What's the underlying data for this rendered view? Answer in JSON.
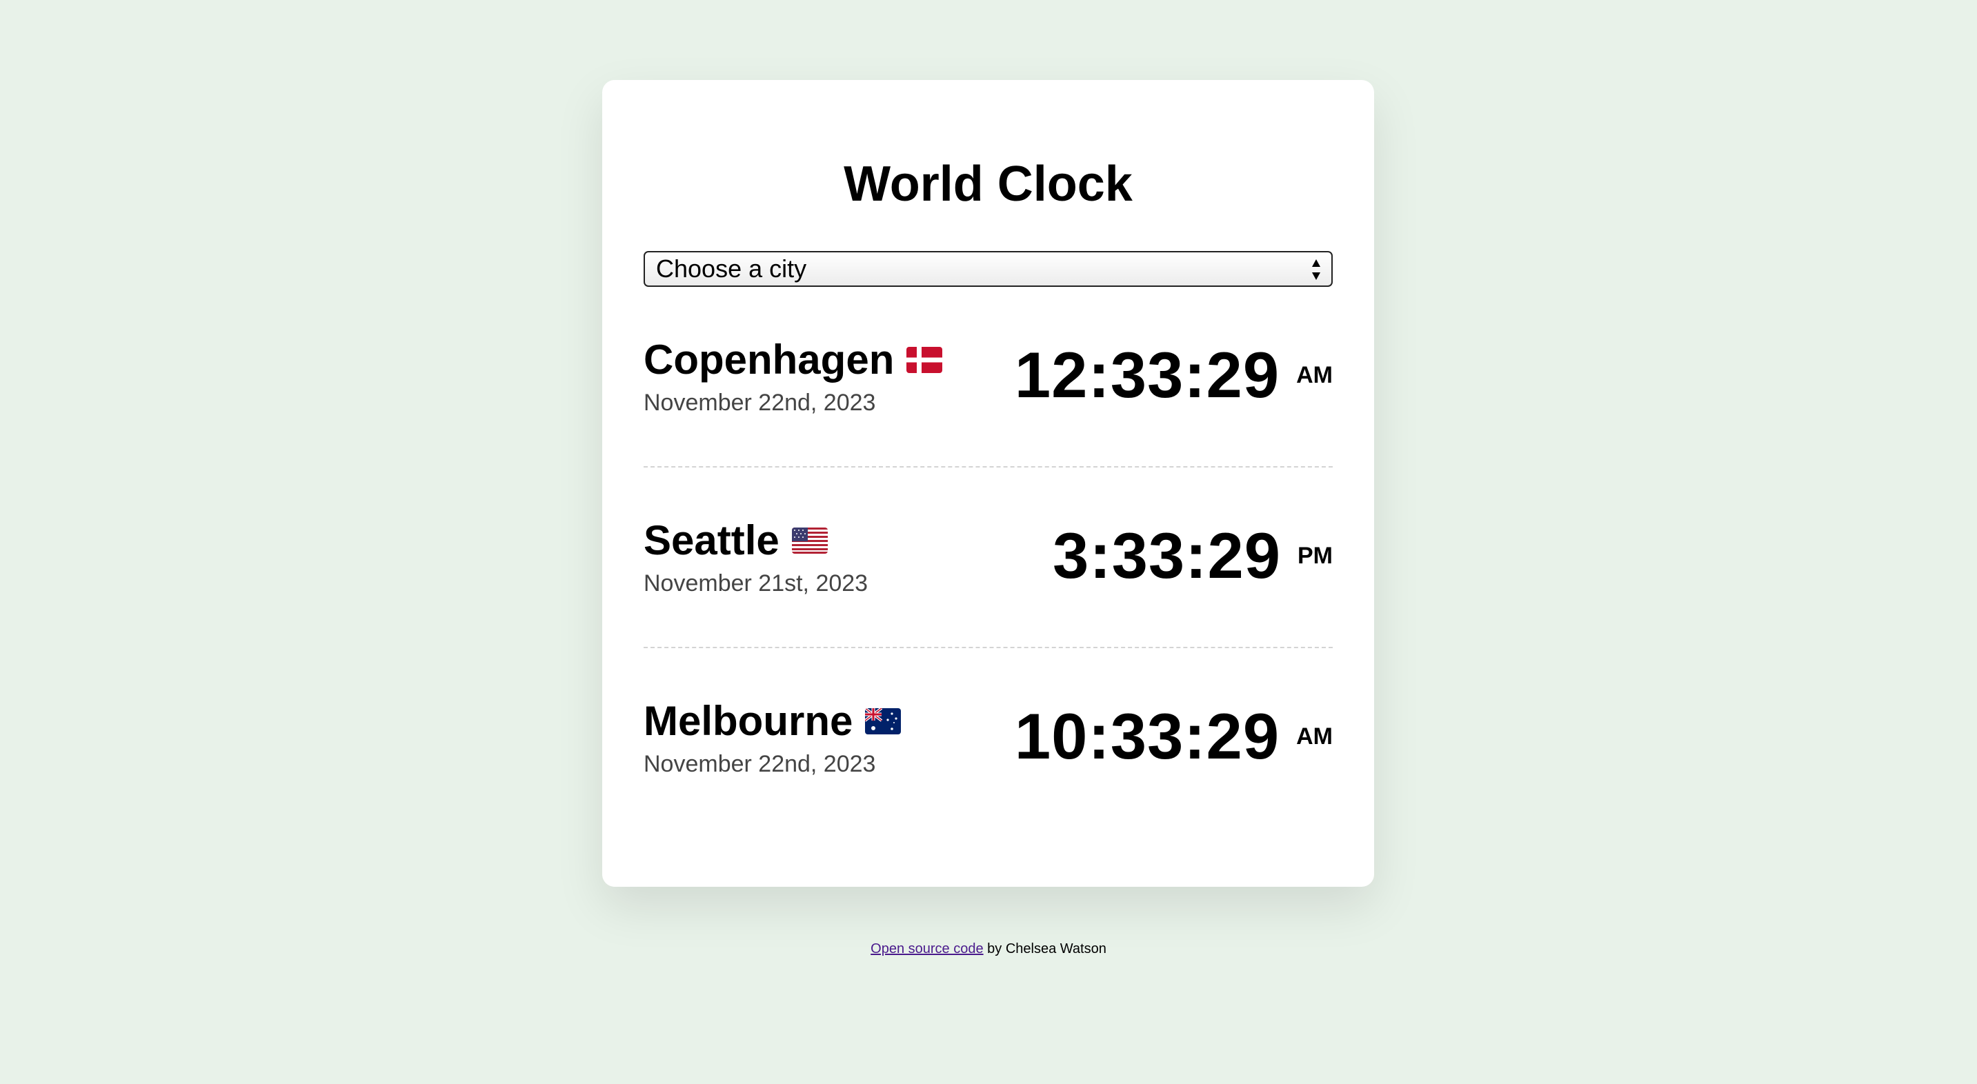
{
  "app": {
    "title": "World Clock"
  },
  "city_select": {
    "selected": "Choose a city"
  },
  "cities": [
    {
      "name": "Copenhagen",
      "flag": "denmark-flag-icon",
      "date": "November 22nd, 2023",
      "time": "12:33:29",
      "ampm": "AM"
    },
    {
      "name": "Seattle",
      "flag": "usa-flag-icon",
      "date": "November 21st, 2023",
      "time": "3:33:29",
      "ampm": "PM"
    },
    {
      "name": "Melbourne",
      "flag": "australia-flag-icon",
      "date": "November 22nd, 2023",
      "time": "10:33:29",
      "ampm": "AM"
    }
  ],
  "footer": {
    "link_text": "Open source code",
    "suffix": " by Chelsea Watson"
  },
  "colors": {
    "page_background": "#e8f2e9",
    "card_background": "#ffffff",
    "link": "#4a1a8c",
    "date_text": "#444444",
    "divider": "#d4d4d4"
  }
}
